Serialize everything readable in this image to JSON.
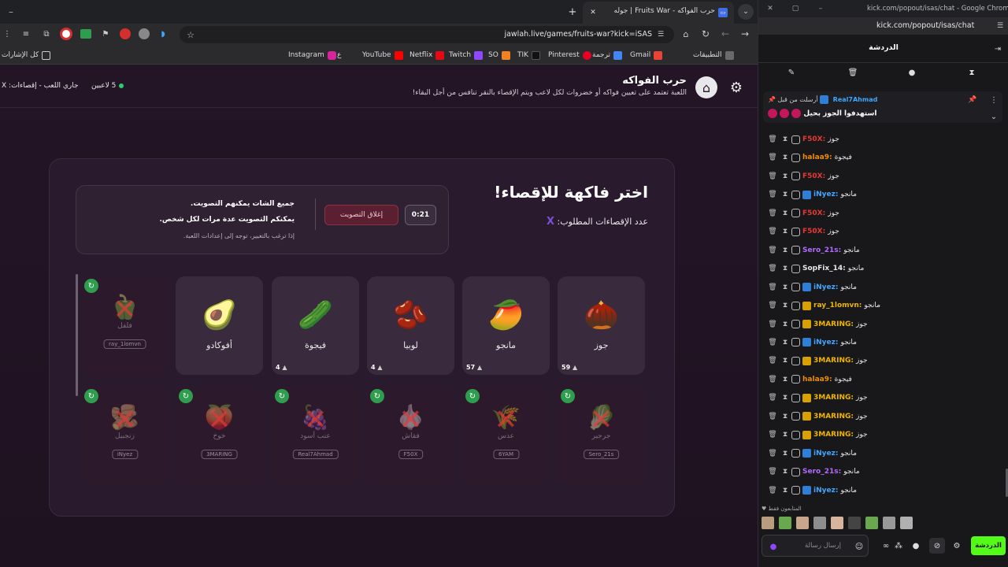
{
  "browser": {
    "tabs": [
      {
        "title": "حرب الفواكه - Fruits War | جوله",
        "close": "✕"
      }
    ],
    "new_tab": "+",
    "url": "jawlah.live/games/fruits-war?kick=iSAS",
    "win_min": "–",
    "bookmarks": [
      "التطبيقات",
      "Gmail",
      "ترجمة",
      "Pinterest",
      "TIK",
      "SO",
      "Twitch",
      "Netflix",
      "YouTube",
      "ع",
      "Instagram"
    ],
    "all_bookmarks": "كل الإشارات"
  },
  "game": {
    "title": "حرب الفواكه",
    "subtitle": "اللعبة تعتمد على تعيين فواكه أو خضروات لكل لاعب ويتم الإقصاء بالنقر تنافس من أجل البقاء!",
    "players": "5 لاعبين",
    "status": "جاري اللعب - إقصاءات: X",
    "heading": "اختر فاكهة للإقصاء!",
    "elim_label": "عدد الإقصاءات المطلوب:",
    "elim_value": "X",
    "timer": "0:21",
    "close_vote": "إغلاق التصويت",
    "info1": "جميع الشات يمكنهم التصويت.",
    "info2": "يمكنكم التصويت عدة مرات لكل شخص.",
    "info3": "إذا ترغب بالتغيير، توجه إلى إعدادات اللعبة.",
    "cards": [
      {
        "name": "جوز",
        "emoji": "🌰",
        "count": "59"
      },
      {
        "name": "مانجو",
        "emoji": "🥭",
        "count": "57"
      },
      {
        "name": "لوبيا",
        "emoji": "🫘",
        "count": "4"
      },
      {
        "name": "فيجوة",
        "emoji": "🥒",
        "count": "4"
      },
      {
        "name": "أفوكادو",
        "emoji": "🥑",
        "count": ""
      }
    ],
    "dead_top": {
      "name": "فلفل",
      "emoji": "🫑",
      "user": "ray_1lomvn"
    },
    "dead_bottom": [
      {
        "name": "جرجير",
        "emoji": "🥬",
        "user": "Sero_21s"
      },
      {
        "name": "عدس",
        "emoji": "🌾",
        "user": "6YAM"
      },
      {
        "name": "فقاش",
        "emoji": "🧄",
        "user": "F50X"
      },
      {
        "name": "عنب أسود",
        "emoji": "🍇",
        "user": "Real7Ahmad"
      },
      {
        "name": "خوخ",
        "emoji": "🍑",
        "user": "3MARING"
      },
      {
        "name": "زنجبيل",
        "emoji": "🫚",
        "user": "iNyez"
      }
    ]
  },
  "chat": {
    "window_title": "kick.com/popout/isas/chat - Google Chrome",
    "url": "kick.com/popout/isas/chat",
    "header": "الدردشة",
    "pinned_by": "أرسلت من قبل",
    "pinned_user": "Real7Ahmad",
    "pinned_msg": "استهدفوا الجوز بحيل",
    "messages": [
      {
        "user": "F50X",
        "msg": "جوز",
        "color": "#e53935",
        "badge": "#555"
      },
      {
        "user": "halaa9",
        "msg": "فيجوة",
        "color": "#f08c00",
        "badge": "#555"
      },
      {
        "user": "F50X",
        "msg": "جوز",
        "color": "#e53935",
        "badge": "#555"
      },
      {
        "user": "iNyez",
        "msg": "مانجو",
        "color": "#3fa7ff",
        "badge": "#2f7fd6"
      },
      {
        "user": "F50X",
        "msg": "جوز",
        "color": "#e53935",
        "badge": "#555"
      },
      {
        "user": "F50X",
        "msg": "جوز",
        "color": "#e53935",
        "badge": "#555"
      },
      {
        "user": "Sero_21s",
        "msg": "مانجو",
        "color": "#b06cff",
        "badge": "#555"
      },
      {
        "user": "SopFix_14",
        "msg": "مانجو",
        "color": "#e8e8ea",
        "badge": "#555"
      },
      {
        "user": "iNyez",
        "msg": "مانجو",
        "color": "#3fa7ff",
        "badge": "#2f7fd6"
      },
      {
        "user": "ray_1lomvn",
        "msg": "مانجو",
        "color": "#f0b400",
        "badge": "#d8a000"
      },
      {
        "user": "3MARING",
        "msg": "جوز",
        "color": "#f0b400",
        "badge": "#d8a000"
      },
      {
        "user": "iNyez",
        "msg": "مانجو",
        "color": "#3fa7ff",
        "badge": "#2f7fd6"
      },
      {
        "user": "3MARING",
        "msg": "جوز",
        "color": "#f0b400",
        "badge": "#d8a000"
      },
      {
        "user": "halaa9",
        "msg": "فيجوة",
        "color": "#f08c00",
        "badge": "#555"
      },
      {
        "user": "3MARING",
        "msg": "جوز",
        "color": "#f0b400",
        "badge": "#d8a000"
      },
      {
        "user": "3MARING",
        "msg": "جوز",
        "color": "#f0b400",
        "badge": "#d8a000"
      },
      {
        "user": "3MARING",
        "msg": "جوز",
        "color": "#f0b400",
        "badge": "#d8a000"
      },
      {
        "user": "iNyez",
        "msg": "مانجو",
        "color": "#3fa7ff",
        "badge": "#2f7fd6"
      },
      {
        "user": "Sero_21s",
        "msg": "مانجو",
        "color": "#b06cff",
        "badge": "#555"
      },
      {
        "user": "iNyez",
        "msg": "مانجو",
        "color": "#3fa7ff",
        "badge": "#2f7fd6"
      }
    ],
    "followers_label": "المتابعون فقط",
    "input_placeholder": "إرسال رسالة",
    "send_label": "الدردشة",
    "accent": "#53fc18"
  }
}
